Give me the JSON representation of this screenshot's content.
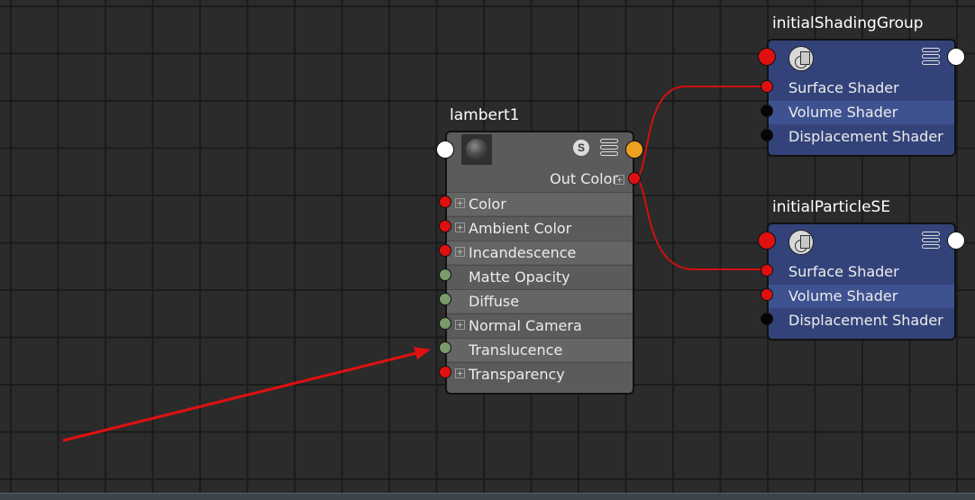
{
  "lambert": {
    "title": "lambert1",
    "out_label": "Out Color",
    "badge": "S",
    "swatch_icon": "material-sphere-icon",
    "rows": [
      {
        "label": "Color",
        "expandable": true,
        "port": "red"
      },
      {
        "label": "Ambient Color",
        "expandable": true,
        "port": "red"
      },
      {
        "label": "Incandescence",
        "expandable": true,
        "port": "red"
      },
      {
        "label": "Matte Opacity",
        "expandable": false,
        "port": "green"
      },
      {
        "label": "Diffuse",
        "expandable": false,
        "port": "green"
      },
      {
        "label": "Normal Camera",
        "expandable": true,
        "port": "green"
      },
      {
        "label": "Translucence",
        "expandable": false,
        "port": "green"
      },
      {
        "label": "Transparency",
        "expandable": true,
        "port": "red"
      }
    ]
  },
  "shading_group": {
    "title": "initialShadingGroup",
    "rows": [
      {
        "label": "Surface Shader",
        "port": "red"
      },
      {
        "label": "Volume Shader",
        "port": "black"
      },
      {
        "label": "Displacement Shader",
        "port": "black"
      }
    ]
  },
  "particle_se": {
    "title": "initialParticleSE",
    "rows": [
      {
        "label": "Surface Shader",
        "port": "red"
      },
      {
        "label": "Volume Shader",
        "port": "red"
      },
      {
        "label": "Displacement Shader",
        "port": "black"
      }
    ]
  },
  "colors": {
    "background": "#2b2b2b",
    "lambert_node": "#5b5b5b",
    "shading_group_node": "#33437a",
    "connection_wire": "#d01010",
    "annotation_arrow": "#e01010",
    "port_red": "#e01010",
    "port_green": "#7a9a6a",
    "port_orange": "#f0a020"
  }
}
